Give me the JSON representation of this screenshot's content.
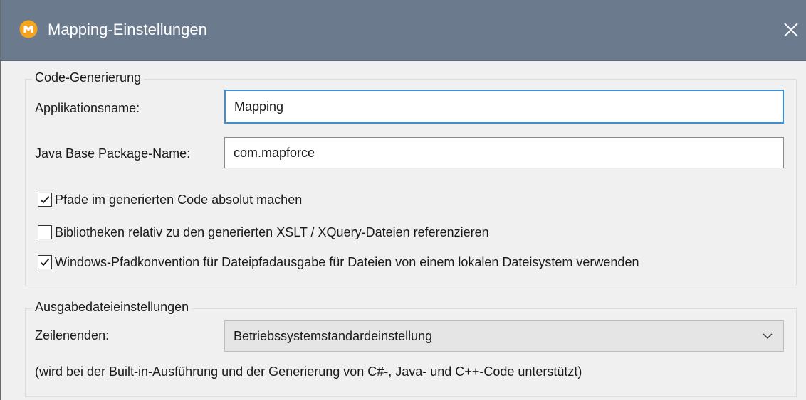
{
  "window": {
    "title": "Mapping-Einstellungen",
    "app_icon": "mapforce-logo-icon",
    "close_icon": "close-icon",
    "accent_color": "#6c7a8e"
  },
  "code_generation": {
    "legend": "Code-Generierung",
    "app_name_label": "Applikationsname:",
    "app_name_value": "Mapping",
    "package_label": "Java Base Package-Name:",
    "package_value": "com.mapforce",
    "options": [
      {
        "label": "Pfade im generierten Code absolut machen",
        "checked": true
      },
      {
        "label": "Bibliotheken relativ zu den generierten XSLT / XQuery-Dateien referenzieren",
        "checked": false
      },
      {
        "label": "Windows-Pfadkonvention für Dateipfadausgabe für Dateien von einem lokalen Dateisystem verwenden",
        "checked": true
      }
    ]
  },
  "output_settings": {
    "legend": "Ausgabedateieinstellungen",
    "line_endings_label": "Zeilenenden:",
    "line_endings_value": "Betriebssystemstandardeinstellung",
    "dropdown_icon": "chevron-down-icon",
    "note": "(wird bei der Built-in-Ausführung und der Generierung von C#-, Java- und C++-Code unterstützt)"
  }
}
